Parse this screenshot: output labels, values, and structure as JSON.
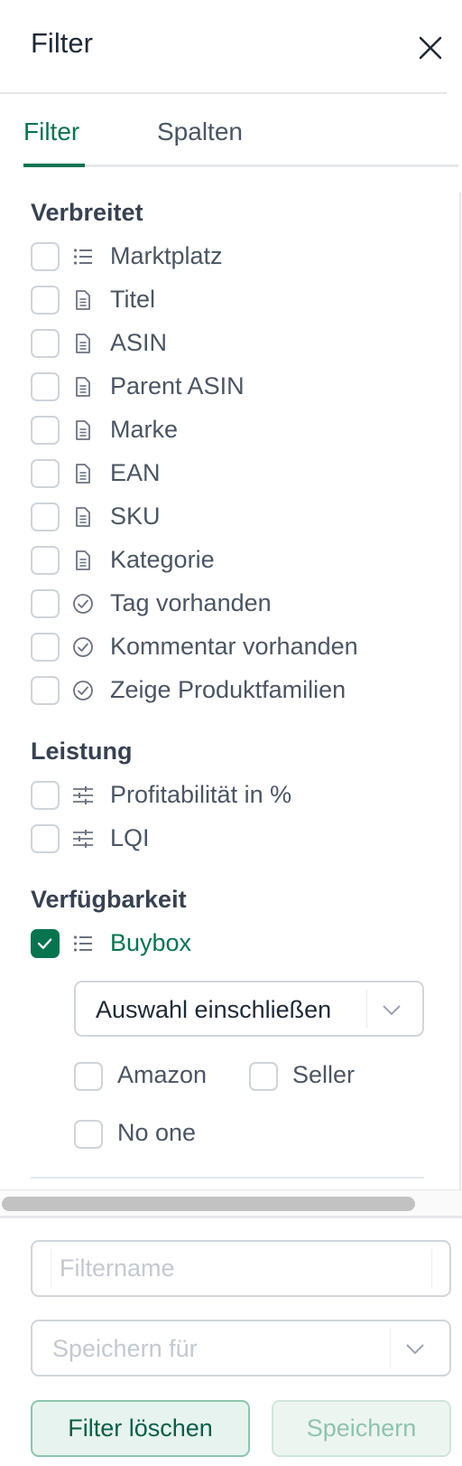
{
  "header": {
    "title": "Filter"
  },
  "tabs": [
    {
      "label": "Filter",
      "active": true
    },
    {
      "label": "Spalten",
      "active": false
    }
  ],
  "sections": {
    "common": {
      "title": "Verbreitet",
      "items": [
        {
          "label": "Marktplatz",
          "icon": "list-icon",
          "checked": false
        },
        {
          "label": "Titel",
          "icon": "document-icon",
          "checked": false
        },
        {
          "label": "ASIN",
          "icon": "document-icon",
          "checked": false
        },
        {
          "label": "Parent ASIN",
          "icon": "document-icon",
          "checked": false
        },
        {
          "label": "Marke",
          "icon": "document-icon",
          "checked": false
        },
        {
          "label": "EAN",
          "icon": "document-icon",
          "checked": false
        },
        {
          "label": "SKU",
          "icon": "document-icon",
          "checked": false
        },
        {
          "label": "Kategorie",
          "icon": "document-icon",
          "checked": false
        },
        {
          "label": "Tag vorhanden",
          "icon": "check-circle-icon",
          "checked": false
        },
        {
          "label": "Kommentar vorhanden",
          "icon": "check-circle-icon",
          "checked": false
        },
        {
          "label": "Zeige Produktfamilien",
          "icon": "check-circle-icon",
          "checked": false
        }
      ]
    },
    "performance": {
      "title": "Leistung",
      "items": [
        {
          "label": "Profitabilität in %",
          "icon": "sliders-icon",
          "checked": false
        },
        {
          "label": "LQI",
          "icon": "sliders-icon",
          "checked": false
        }
      ]
    },
    "availability": {
      "title": "Verfügbarkeit",
      "items": [
        {
          "label": "Buybox",
          "icon": "list-icon",
          "checked": true
        }
      ],
      "buybox": {
        "mode_select": "Auswahl einschließen",
        "options": [
          {
            "label": "Amazon",
            "checked": false
          },
          {
            "label": "Seller",
            "checked": false
          },
          {
            "label": "No one",
            "checked": false
          }
        ]
      }
    }
  },
  "footer": {
    "filter_name_placeholder": "Filtername",
    "save_for_placeholder": "Speichern für",
    "clear_label": "Filter löschen",
    "save_label": "Speichern"
  },
  "colors": {
    "accent": "#077450",
    "text": "#4b5563",
    "border": "#d1d5db"
  }
}
